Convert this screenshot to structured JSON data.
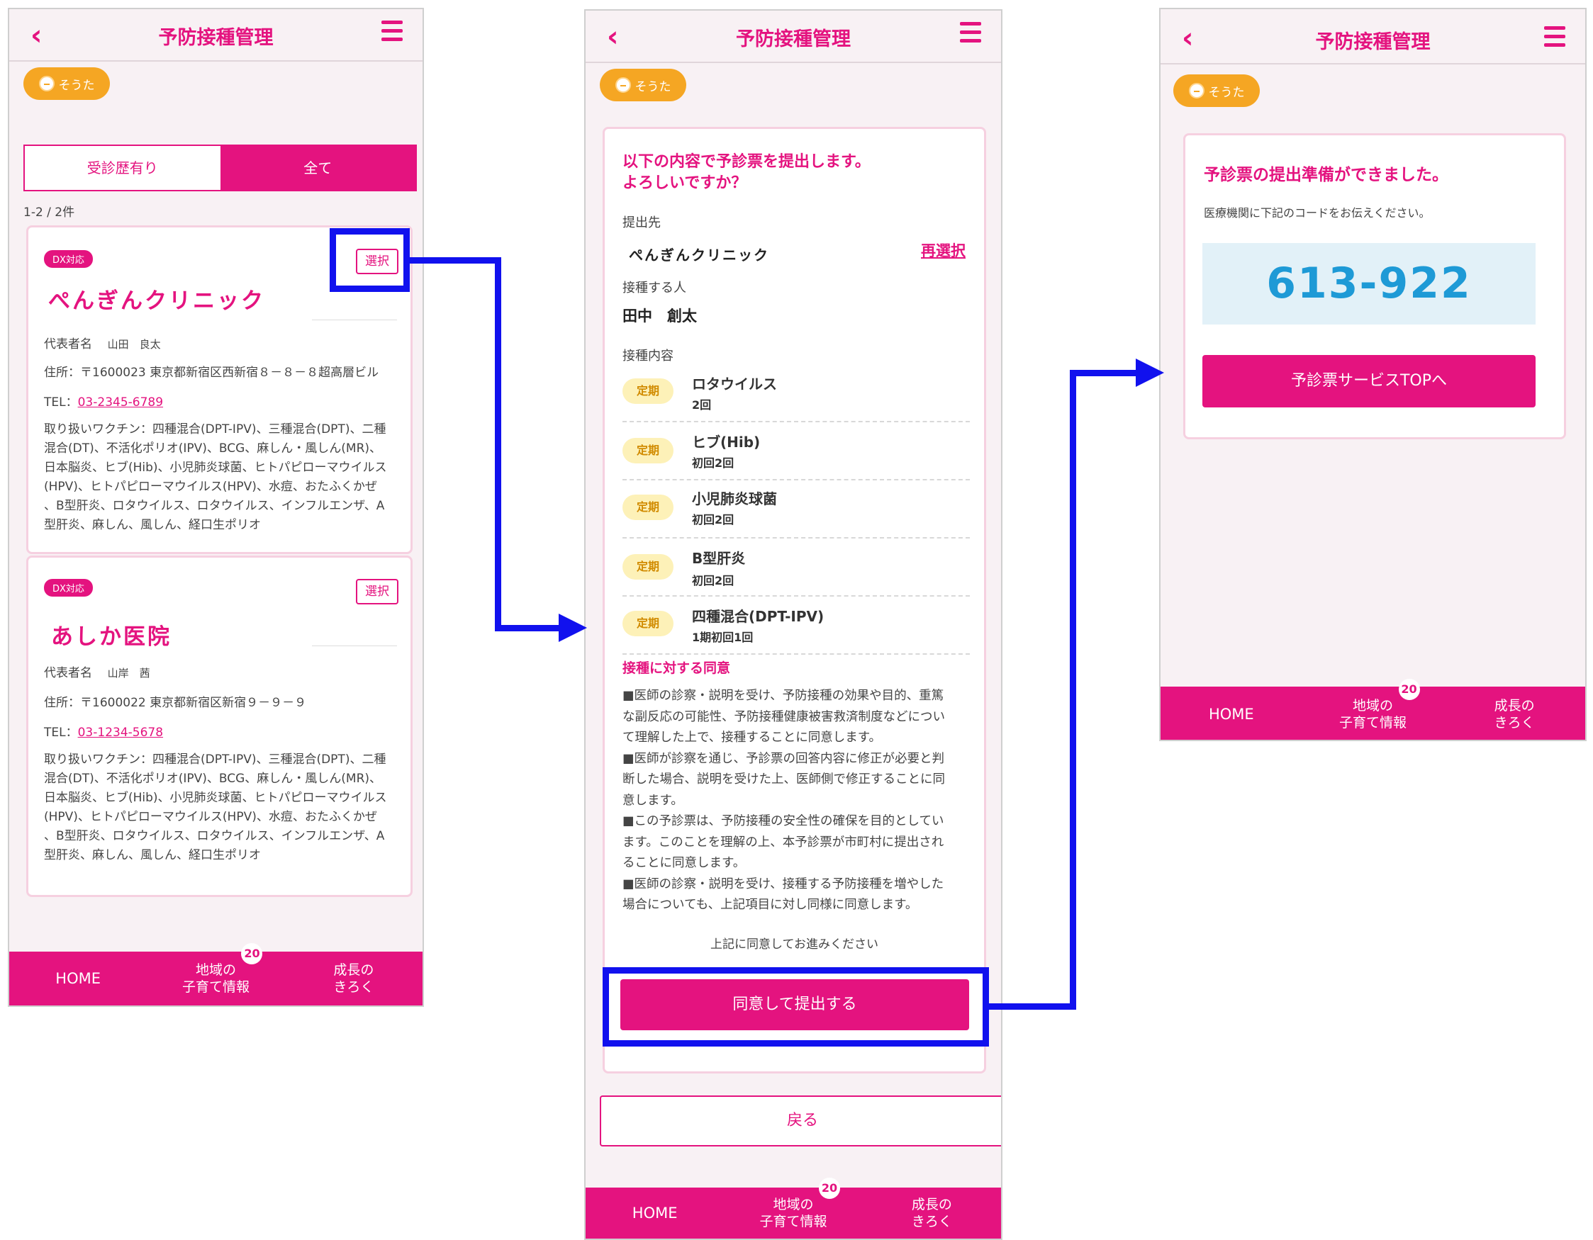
{
  "app_title": "予防接種管理",
  "child_name": "そうた",
  "nav": {
    "home": "HOME",
    "local_line1": "地域の",
    "local_line2": "子育て情報",
    "local_badge": "20",
    "growth_line1": "成長の",
    "growth_line2": "きろく"
  },
  "screen1": {
    "tabs": {
      "visited": "受診歴有り",
      "all": "全て"
    },
    "count": "1-2 / 2件",
    "clinics": [
      {
        "tag": "DX対応",
        "select": "選択",
        "name": "ぺんぎんクリニック",
        "rep_label": "代表者名",
        "rep_name": "山田　良太",
        "address": "住所：〒1600023 東京都新宿区西新宿８－８－８超高層ビル",
        "tel_label": "TEL：",
        "tel": "03-2345-6789",
        "vaccines": [
          "取り扱いワクチン：四種混合(DPT-IPV)、三種混合(DPT)、二種",
          "混合(DT)、不活化ポリオ(IPV)、BCG、麻しん・風しん(MR)、",
          "日本脳炎、ヒブ(Hib)、小児肺炎球菌、ヒトパピローマウイルス",
          "(HPV)、ヒトパピローマウイルス(HPV)、水痘、おたふくかぜ",
          "、B型肝炎、ロタウイルス、ロタウイルス、インフルエンザ、A",
          "型肝炎、麻しん、風しん、経口生ポリオ"
        ]
      },
      {
        "tag": "DX対応",
        "select": "選択",
        "name": "あしか医院",
        "rep_label": "代表者名",
        "rep_name": "山岸　茜",
        "address": "住所：〒1600022 東京都新宿区新宿９－９－９",
        "tel_label": "TEL：",
        "tel": "03-1234-5678",
        "vaccines": [
          "取り扱いワクチン：四種混合(DPT-IPV)、三種混合(DPT)、二種",
          "混合(DT)、不活化ポリオ(IPV)、BCG、麻しん・風しん(MR)、",
          "日本脳炎、ヒブ(Hib)、小児肺炎球菌、ヒトパピローマウイルス",
          "(HPV)、ヒトパピローマウイルス(HPV)、水痘、おたふくかぜ",
          "、B型肝炎、ロタウイルス、ロタウイルス、インフルエンザ、A",
          "型肝炎、麻しん、風しん、経口生ポリオ"
        ]
      }
    ]
  },
  "screen2": {
    "heading1": "以下の内容で予診票を提出します。",
    "heading2": "よろしいですか？",
    "dest_label": "提出先",
    "dest_name": "ぺんぎんクリニック",
    "reselect": "再選択",
    "person_label": "接種する人",
    "person_name": "田中　創太",
    "content_label": "接種内容",
    "vaccines": [
      {
        "tag": "定期",
        "name": "ロタウイルス",
        "dose": "2回"
      },
      {
        "tag": "定期",
        "name": "ヒブ(Hib)",
        "dose": "初回2回"
      },
      {
        "tag": "定期",
        "name": "小児肺炎球菌",
        "dose": "初回2回"
      },
      {
        "tag": "定期",
        "name": "B型肝炎",
        "dose": "初回2回"
      },
      {
        "tag": "定期",
        "name": "四種混合(DPT-IPV)",
        "dose": "1期初回1回"
      }
    ],
    "consent_title": "接種に対する同意",
    "consent_lines": [
      "■医師の診察・説明を受け、予防接種の効果や目的、重篤",
      "な副反応の可能性、予防接種健康被害救済制度などについ",
      "て理解した上で、接種することに同意します。",
      "■医師が診察を通じ、予診票の回答内容に修正が必要と判",
      "断した場合、説明を受けた上、医師側で修正することに同",
      "意します。",
      "■この予診票は、予防接種の安全性の確保を目的としてい",
      "ます。このことを理解の上、本予診票が市町村に提出され",
      "ることに同意します。",
      "■医師の診察・説明を受け、接種する予防接種を増やした",
      "場合についても、上記項目に対し同様に同意します。"
    ],
    "proceed_note": "上記に同意してお進みください",
    "submit": "同意して提出する",
    "back": "戻る"
  },
  "screen3": {
    "heading": "予診票の提出準備ができました。",
    "note": "医療機関に下記のコードをお伝えください。",
    "code": "613-922",
    "top_button": "予診票サービスTOPへ"
  },
  "colors": {
    "accent": "#e4137f",
    "highlight": "#1111ee",
    "chip": "#f5a623",
    "code": "#1e9ad6"
  }
}
